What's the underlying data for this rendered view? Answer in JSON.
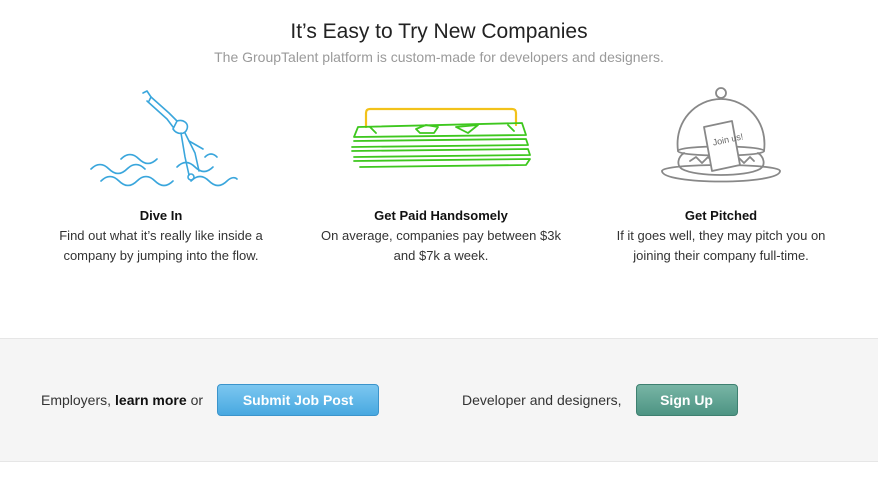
{
  "header": {
    "title": "It’s Easy to Try New Companies",
    "subtitle": "The GroupTalent platform is custom-made for developers and designers."
  },
  "features": [
    {
      "icon": "diver-icon",
      "title": "Dive In",
      "description": "Find out what it’s really like inside a company by jumping into the flow."
    },
    {
      "icon": "money-stack-icon",
      "title": "Get Paid Handsomely",
      "description": "On average, companies pay between $3k and $7k a week."
    },
    {
      "icon": "cloche-icon",
      "icon_text": "Join us!",
      "title": "Get Pitched",
      "description": "If it goes well, they may pitch you on joining their company full-time."
    }
  ],
  "cta": {
    "employers_prefix": "Employers,",
    "employers_link": "learn more",
    "employers_suffix": "or",
    "submit_button": "Submit Job Post",
    "developers_text": "Developer and designers,",
    "signup_button": "Sign Up"
  },
  "colors": {
    "diver_stroke": "#3aa6dc",
    "money_green": "#3ec71e",
    "money_yellow": "#f2c21a",
    "cloche_gray": "#888888",
    "submit_blue": "#48a8e0",
    "signup_green": "#4d9483"
  }
}
